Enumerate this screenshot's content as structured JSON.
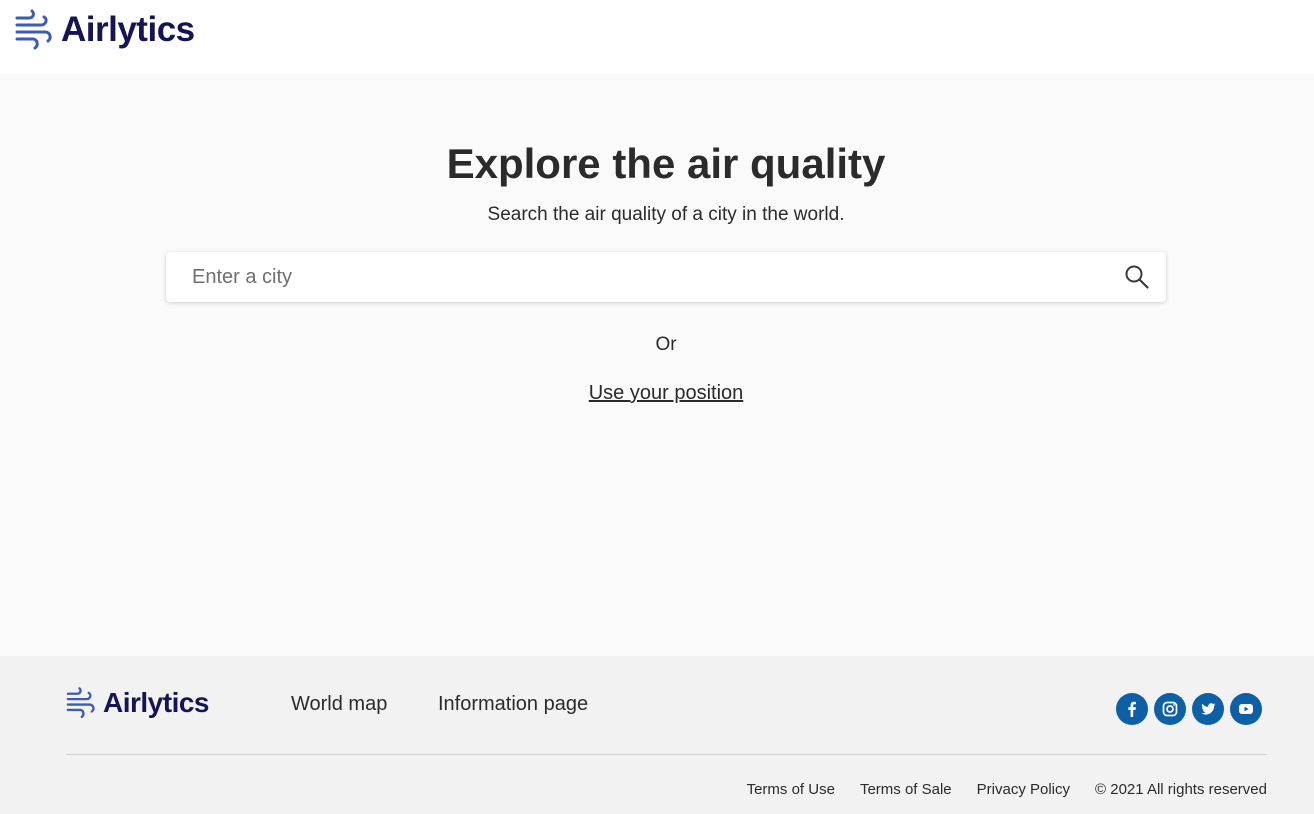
{
  "brand": {
    "name": "Airlytics",
    "color": "#141552",
    "icon_color": "#3b5bb5"
  },
  "hero": {
    "title": "Explore the air quality",
    "subtitle": "Search the air quality of a city in the world.",
    "search": {
      "placeholder": "Enter a city",
      "value": "",
      "icon": "search-icon"
    },
    "or_text": "Or",
    "position_link": "Use your position"
  },
  "footer": {
    "brand": "Airlytics",
    "nav": [
      {
        "label": "World map"
      },
      {
        "label": "Information page"
      }
    ],
    "socials": [
      {
        "name": "facebook-icon"
      },
      {
        "name": "instagram-icon"
      },
      {
        "name": "twitter-icon"
      },
      {
        "name": "youtube-icon"
      }
    ],
    "social_color": "#0d5fa6",
    "legal": [
      {
        "label": "Terms of Use"
      },
      {
        "label": "Terms of Sale"
      },
      {
        "label": "Privacy Policy"
      }
    ],
    "copyright": "© 2021 All rights reserved"
  }
}
